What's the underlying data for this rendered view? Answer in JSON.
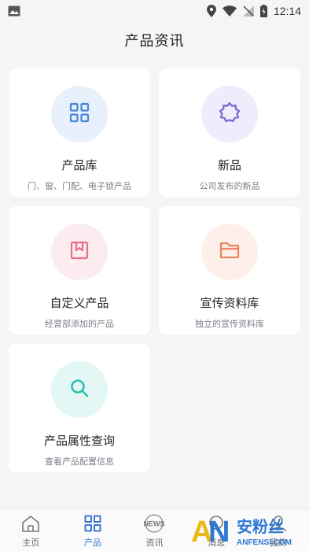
{
  "status_bar": {
    "time": "12:14",
    "icons": [
      "image-icon",
      "location-icon",
      "wifi-icon",
      "signal-off-icon",
      "battery-charging-icon"
    ]
  },
  "page": {
    "title": "产品资讯"
  },
  "cards": [
    {
      "title": "产品库",
      "subtitle": "门、窗、门配、电子锁产品",
      "icon": "grid-icon",
      "circle_color": "#e8f0fb",
      "icon_color": "#4a86d8"
    },
    {
      "title": "新品",
      "subtitle": "公司发布的新品",
      "icon": "badge-icon",
      "circle_color": "#efecfb",
      "icon_color": "#7b6fd6"
    },
    {
      "title": "自定义产品",
      "subtitle": "经营部添加的产品",
      "icon": "bookmark-box-icon",
      "circle_color": "#fdecef",
      "icon_color": "#e56f8c"
    },
    {
      "title": "宣传资料库",
      "subtitle": "独立的宣传资料库",
      "icon": "folder-icon",
      "circle_color": "#fdefe9",
      "icon_color": "#ec8560"
    },
    {
      "title": "产品属性查询",
      "subtitle": "查看产品配置信息",
      "icon": "search-icon",
      "circle_color": "#e3f7f5",
      "icon_color": "#2fbfb3"
    }
  ],
  "tabbar": {
    "active_color": "#3a76d6",
    "items": [
      {
        "label": "主页",
        "icon": "home-icon"
      },
      {
        "label": "产品",
        "icon": "grid-icon"
      },
      {
        "label": "资讯",
        "icon": "news-icon"
      },
      {
        "label": "消息",
        "icon": "message-icon"
      },
      {
        "label": "我的",
        "icon": "profile-icon"
      }
    ]
  },
  "watermark": {
    "text_main": "安粉丝",
    "text_sub": "ANFENSI.COM",
    "logo": "AN"
  }
}
